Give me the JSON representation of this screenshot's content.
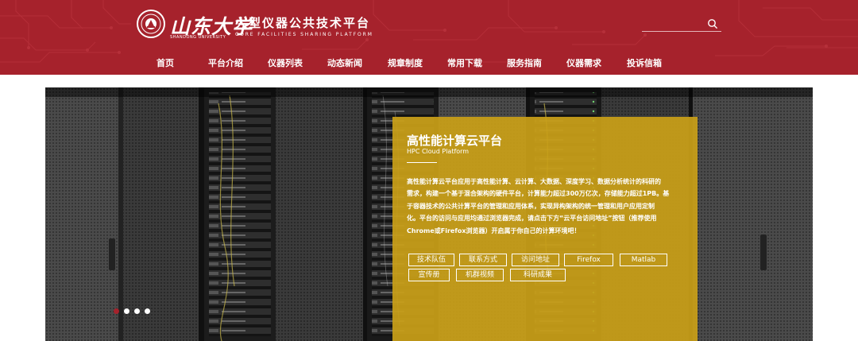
{
  "header": {
    "school_name": "山东大学",
    "school_name_en": "SHANDONG UNIVERSITY",
    "platform_title": "大型仪器公共技术平台",
    "platform_title_en": "CORE FACILITIES SHARING PLATFORM",
    "search": {
      "value": "",
      "placeholder": "",
      "icon": "search-icon"
    }
  },
  "nav": {
    "items": [
      {
        "label": "首页"
      },
      {
        "label": "平台介绍"
      },
      {
        "label": "仪器列表"
      },
      {
        "label": "动态新闻"
      },
      {
        "label": "规章制度"
      },
      {
        "label": "常用下载"
      },
      {
        "label": "服务指南"
      },
      {
        "label": "仪器需求"
      },
      {
        "label": "投诉信箱"
      }
    ]
  },
  "banner": {
    "slides": 4,
    "active_slide": 0
  },
  "card": {
    "title": "高性能计算云平台",
    "subtitle": "HPC Cloud Platform",
    "description_lines": [
      "高性能计算云平台应用于高性能计算、云计算、大数据、深度学习、数据分析统计的科研的",
      "需求，构建一个基于混合架构的硬件平台，计算能力超过300万亿次，存储能力超过1PB。基",
      "于容器技术的公共计算平台的管理和应用体系，实现异构架构的统一管理和用户应用定制",
      "化。平台的访问与应用均通过浏览器完成，请点击下方“云平台访问地址”按钮（推荐使用",
      "Chrome或Firefox浏览器）开启属于你自己的计算环境吧！"
    ],
    "buttons_row1": [
      "技术队伍",
      "联系方式",
      "访问地址",
      "Firefox",
      "Matlab"
    ],
    "buttons_row2": [
      "宣传册",
      "机群视频",
      "科研成果"
    ]
  },
  "colors": {
    "brand_red": "#a6222c",
    "card_gold": "#c99f18",
    "white": "#ffffff"
  }
}
